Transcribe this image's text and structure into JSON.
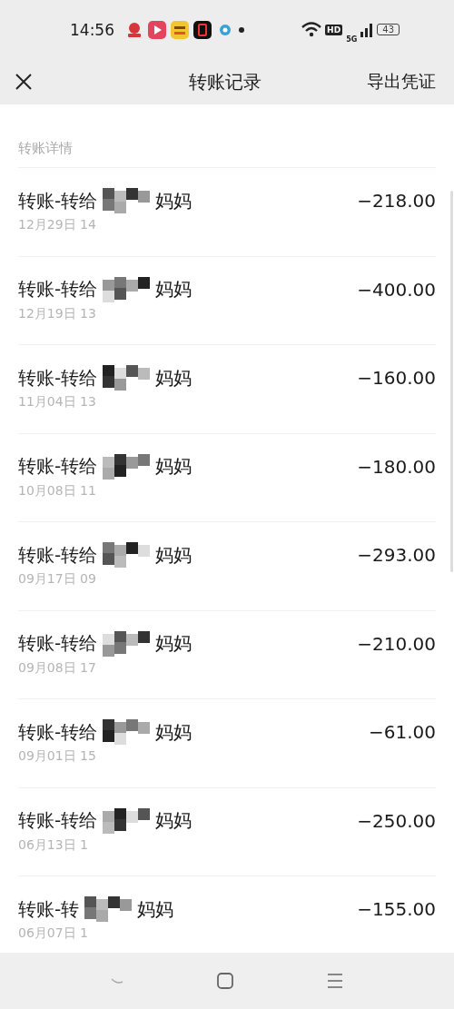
{
  "status_bar": {
    "time": "14:56",
    "hd": "HD",
    "network": "5G",
    "battery": "43"
  },
  "header": {
    "title": "转账记录",
    "action": "导出凭证"
  },
  "section": {
    "label": "转账详情"
  },
  "transactions": [
    {
      "prefix": "转账-转给",
      "suffix": "妈妈",
      "date": "12月29日 14",
      "amount": "−218.00"
    },
    {
      "prefix": "转账-转给",
      "suffix": "妈妈",
      "date": "12月19日 13",
      "amount": "−400.00"
    },
    {
      "prefix": "转账-转给",
      "suffix": "妈妈",
      "date": "11月04日 13",
      "amount": "−160.00"
    },
    {
      "prefix": "转账-转给",
      "suffix": "妈妈",
      "date": "10月08日 11",
      "amount": "−180.00"
    },
    {
      "prefix": "转账-转给",
      "suffix": "妈妈",
      "date": "09月17日 09",
      "amount": "−293.00"
    },
    {
      "prefix": "转账-转给",
      "suffix": "妈妈",
      "date": "09月08日 17",
      "amount": "−210.00"
    },
    {
      "prefix": "转账-转给",
      "suffix": "妈妈",
      "date": "09月01日 15",
      "amount": "−61.00"
    },
    {
      "prefix": "转账-转给",
      "suffix": "妈妈",
      "date": "06月13日 1",
      "amount": "−250.00"
    },
    {
      "prefix": "转账-转",
      "suffix": "妈妈",
      "date": "06月07日 1",
      "amount": "−155.00"
    }
  ]
}
